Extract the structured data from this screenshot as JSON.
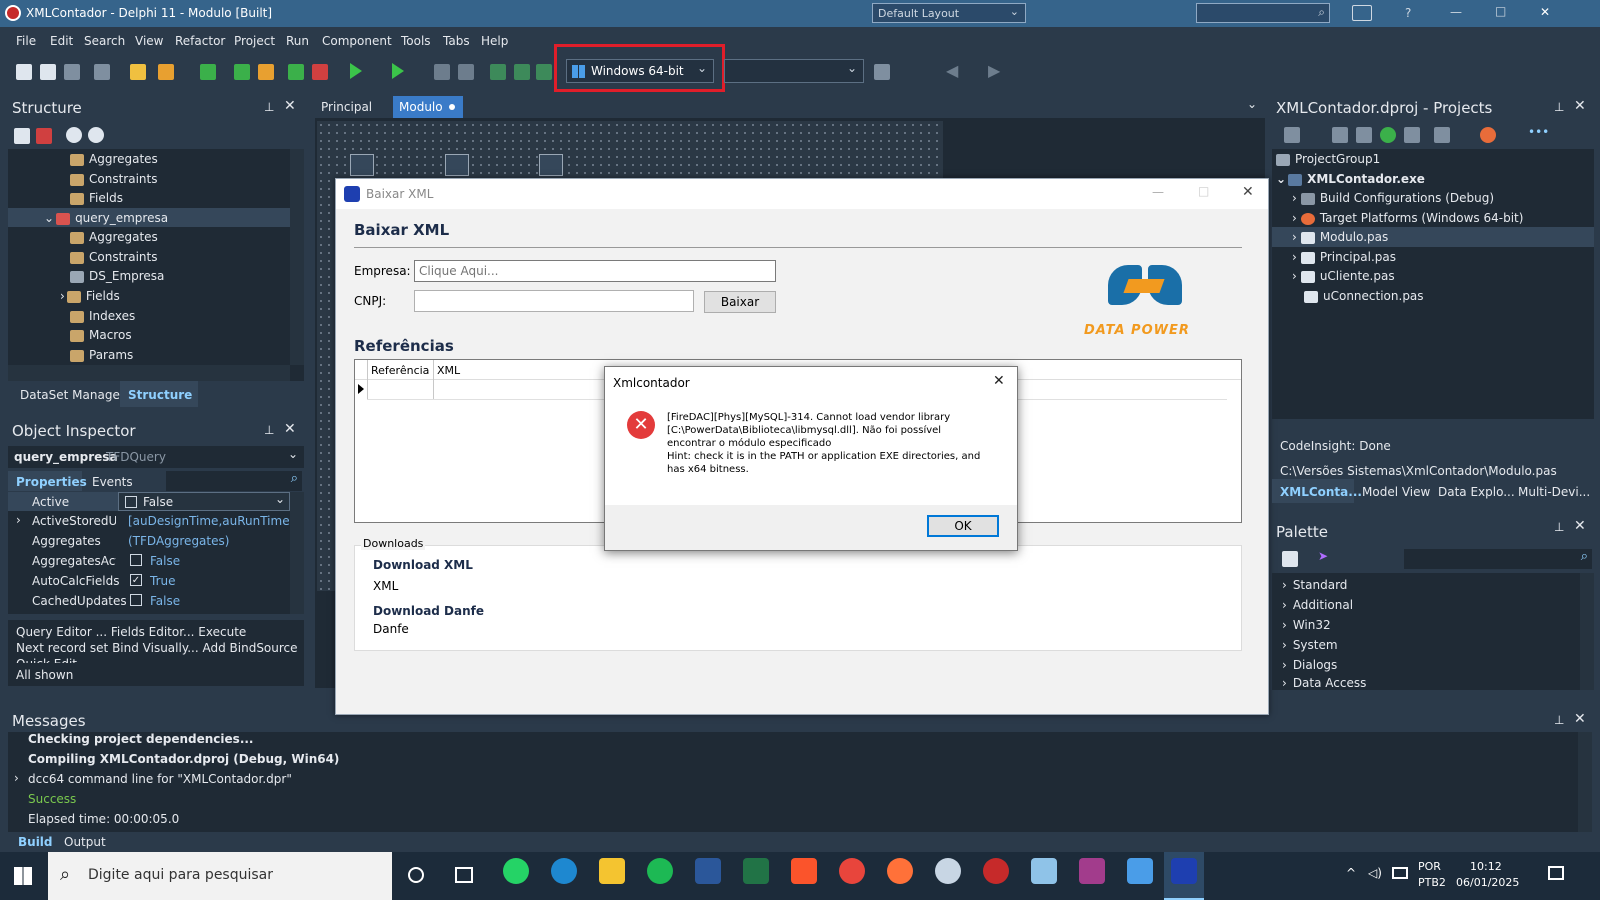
{
  "titlebar": {
    "title": "XMLContador - Delphi 11 - Modulo [Built]",
    "layout_select": "Default Layout",
    "help": "?",
    "min": "—",
    "max": "□",
    "close": "✕"
  },
  "menu": [
    "File",
    "Edit",
    "Search",
    "View",
    "Refactor",
    "Project",
    "Run",
    "Component",
    "Tools",
    "Tabs",
    "Help"
  ],
  "toolbar": {
    "platform": "Windows 64-bit"
  },
  "structure": {
    "title": "Structure",
    "items": [
      {
        "label": "Aggregates"
      },
      {
        "label": "Constraints"
      },
      {
        "label": "Fields"
      },
      {
        "label": "query_empresa"
      },
      {
        "label": "Aggregates"
      },
      {
        "label": "Constraints"
      },
      {
        "label": "DS_Empresa"
      },
      {
        "label": "Fields"
      },
      {
        "label": "Indexes"
      },
      {
        "label": "Macros"
      },
      {
        "label": "Params"
      }
    ],
    "tabs": [
      "DataSet Manager",
      "Structure"
    ]
  },
  "inspector": {
    "title": "Object Inspector",
    "object": "query_empresa",
    "object_type": "TFDQuery",
    "tabs": [
      "Properties",
      "Events"
    ],
    "rows": [
      {
        "name": "Active",
        "value": "False"
      },
      {
        "name": "ActiveStoredUsa",
        "value": "[auDesignTime,auRunTime]"
      },
      {
        "name": "Aggregates",
        "value": "(TFDAggregates)"
      },
      {
        "name": "AggregatesActiv",
        "value": "False"
      },
      {
        "name": "AutoCalcFields",
        "value": "True"
      },
      {
        "name": "CachedUpdates",
        "value": "False"
      }
    ],
    "actions_line1": "Query Editor ...  Fields Editor...  Execute",
    "actions_line2": "Next record set  Bind Visually...  Add BindSource",
    "actions_line3": "Quick Edit...",
    "status": "All shown"
  },
  "editor_tabs": [
    "Principal",
    "Modulo"
  ],
  "form_window": {
    "caption": "Baixar XML",
    "heading": "Baixar XML",
    "empresa_label": "Empresa:",
    "empresa_placeholder": "Clique Aqui...",
    "cnpj_label": "CNPJ:",
    "cnpj_value": "",
    "baixar_btn": "Baixar",
    "logo_text": "DATA POWER",
    "ref_heading": "Referências",
    "grid_cols": [
      "Referência",
      "XML"
    ],
    "downloads_caption": "Downloads",
    "download_xml_title": "Download XML",
    "download_xml_value": "XML",
    "download_danfe_title": "Download Danfe",
    "download_danfe_value": "Danfe"
  },
  "dialog": {
    "title": "Xmlcontador",
    "msg_line1": "[FireDAC][Phys][MySQL]-314. Cannot load vendor library",
    "msg_line2": "[C:\\PowerData\\Biblioteca\\libmysql.dll]. Não foi possível",
    "msg_line3": "encontrar o módulo especificado",
    "msg_line4": "Hint: check it is in the PATH or application EXE directories, and",
    "msg_line5": "has x64 bitness.",
    "ok": "OK"
  },
  "projects": {
    "title": "XMLContador.dproj - Projects",
    "items": [
      {
        "label": "ProjectGroup1"
      },
      {
        "label": "XMLContador.exe"
      },
      {
        "label": "Build Configurations (Debug)"
      },
      {
        "label": "Target Platforms (Windows 64-bit)"
      },
      {
        "label": "Modulo.pas"
      },
      {
        "label": "Principal.pas"
      },
      {
        "label": "uCliente.pas"
      },
      {
        "label": "uConnection.pas"
      }
    ],
    "codeinsight": "CodeInsight: Done",
    "path": "C:\\Versões Sistemas\\XmlContador\\Modulo.pas",
    "tabs": [
      "XMLConta...",
      "Model View",
      "Data Explo...",
      "Multi-Devi..."
    ]
  },
  "palette": {
    "title": "Palette",
    "items": [
      "Standard",
      "Additional",
      "Win32",
      "System",
      "Dialogs",
      "Data Access"
    ]
  },
  "messages": {
    "title": "Messages",
    "lines": [
      "Checking project dependencies...",
      "Compiling XMLContador.dproj (Debug, Win64)",
      "dcc64 command line for \"XMLContador.dpr\"",
      "Success",
      "Elapsed time: 00:00:05.0"
    ],
    "tabs": [
      "Build",
      "Output"
    ]
  },
  "taskbar": {
    "search": "Digite aqui para pesquisar",
    "lang1": "POR",
    "lang2": "PTB2",
    "time": "10:12",
    "date": "06/01/2025"
  },
  "colors": {
    "ide_bg": "#2b3a4a",
    "title_bg": "#36648b",
    "highlight_red": "#e01e2a",
    "logo_blue": "#1a6fa8",
    "logo_orange": "#f29a1f",
    "success_green": "#7ac94e"
  }
}
